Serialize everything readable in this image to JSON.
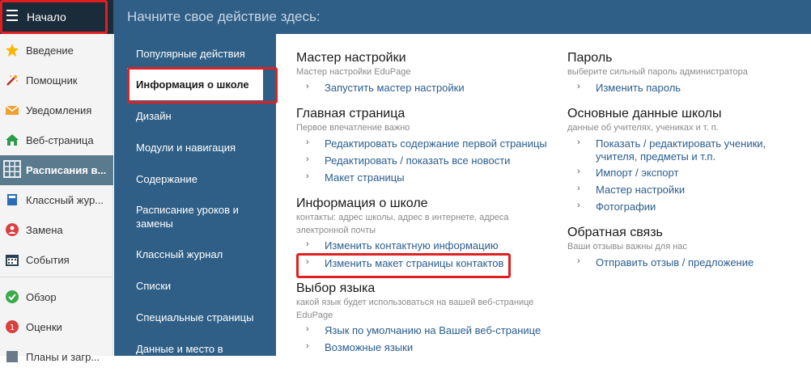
{
  "header": {
    "home_label": "Начало",
    "prompt": "Начните свое действие здесь:"
  },
  "sidebar": {
    "items": [
      {
        "label": "Введение",
        "icon": "star-icon"
      },
      {
        "label": "Помощник",
        "icon": "magic-wand-icon"
      },
      {
        "label": "Уведомления",
        "icon": "envelope-icon"
      },
      {
        "label": "Веб-страница",
        "icon": "house-icon"
      },
      {
        "label": "Расписания в...",
        "icon": "grid-icon"
      },
      {
        "label": "Классный жур...",
        "icon": "book-icon"
      },
      {
        "label": "Замена",
        "icon": "person-icon"
      },
      {
        "label": "События",
        "icon": "calendar-icon"
      },
      {
        "label": "Обзор",
        "icon": "check-circle-icon"
      },
      {
        "label": "Оценки",
        "icon": "grades-icon"
      },
      {
        "label": "Планы и загр...",
        "icon": "plan-icon"
      }
    ]
  },
  "nav": {
    "items": [
      "Популярные действия",
      "Информация о школе",
      "Дизайн",
      "Модули и навигация",
      "Содержание",
      "Расписание уроков и замены",
      "Классный журнал",
      "Списки",
      "Специальные страницы",
      "Данные и место в"
    ]
  },
  "content": {
    "left": [
      {
        "title": "Мастер настройки",
        "sub": "Мастер настройки EduPage",
        "links": [
          "Запустить мастер настройки"
        ]
      },
      {
        "title": "Главная страница",
        "sub": "Первое впечатление важно",
        "links": [
          "Редактировать содержание первой страницы",
          "Редактировать / показать все новости",
          "Макет страницы"
        ]
      },
      {
        "title": "Информация о школе",
        "sub": "контакты: адрес школы, адрес в интернете, адреса электронной почты",
        "links": [
          "Изменить контактную информацию",
          "Изменить макет страницы контактов"
        ]
      },
      {
        "title": "Выбор языка",
        "sub": "какой язык будет использоваться на вашей веб-странице EduPage",
        "links": [
          "Язык по умолчанию на Вашей веб-странице",
          "Возможные языки"
        ]
      }
    ],
    "right": [
      {
        "title": "Пароль",
        "sub": "выберите сильный пароль администратора",
        "links": [
          "Изменить пароль"
        ]
      },
      {
        "title": "Основные данные школы",
        "sub": "данные об учителях, учениках и т. п.",
        "links": [
          "Показать / редактировать ученики, учителя, предметы и т.п.",
          "Импорт / экспорт",
          "Мастер настройки",
          "Фотографии"
        ]
      },
      {
        "title": "Обратная связь",
        "sub": "Ваши отзывы важны для нас",
        "links": [
          "Отправить отзыв / предложение"
        ]
      }
    ]
  },
  "colors": {
    "header_bg": "#2f5f86",
    "highlight": "#e02020",
    "link": "#2a5d8f"
  }
}
